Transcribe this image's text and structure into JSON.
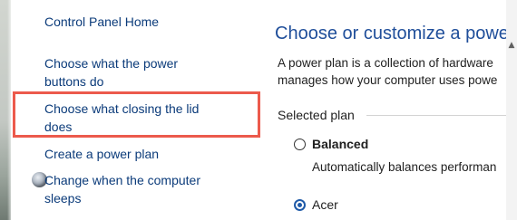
{
  "nav": {
    "home": "Control Panel Home",
    "power_buttons": "Choose what the power buttons do",
    "closing_lid": "Choose what closing the lid does",
    "create_plan": "Create a power plan",
    "sleep": "Change when the computer sleeps",
    "sleep_icon": "moon-icon"
  },
  "main": {
    "title": "Choose or customize a power p",
    "description_line1": "A power plan is a collection of hardware",
    "description_line2": "manages how your computer uses powe",
    "selected_plan_label": "Selected plan",
    "plans": [
      {
        "name": "Balanced",
        "description": "Automatically balances performan",
        "selected": false
      },
      {
        "name": "Acer",
        "selected": true
      }
    ]
  },
  "colors": {
    "highlight": "#ec5a4c",
    "link": "#0b3b7a",
    "title": "#1f4e9a",
    "radio_selected": "#1f5aa8"
  }
}
